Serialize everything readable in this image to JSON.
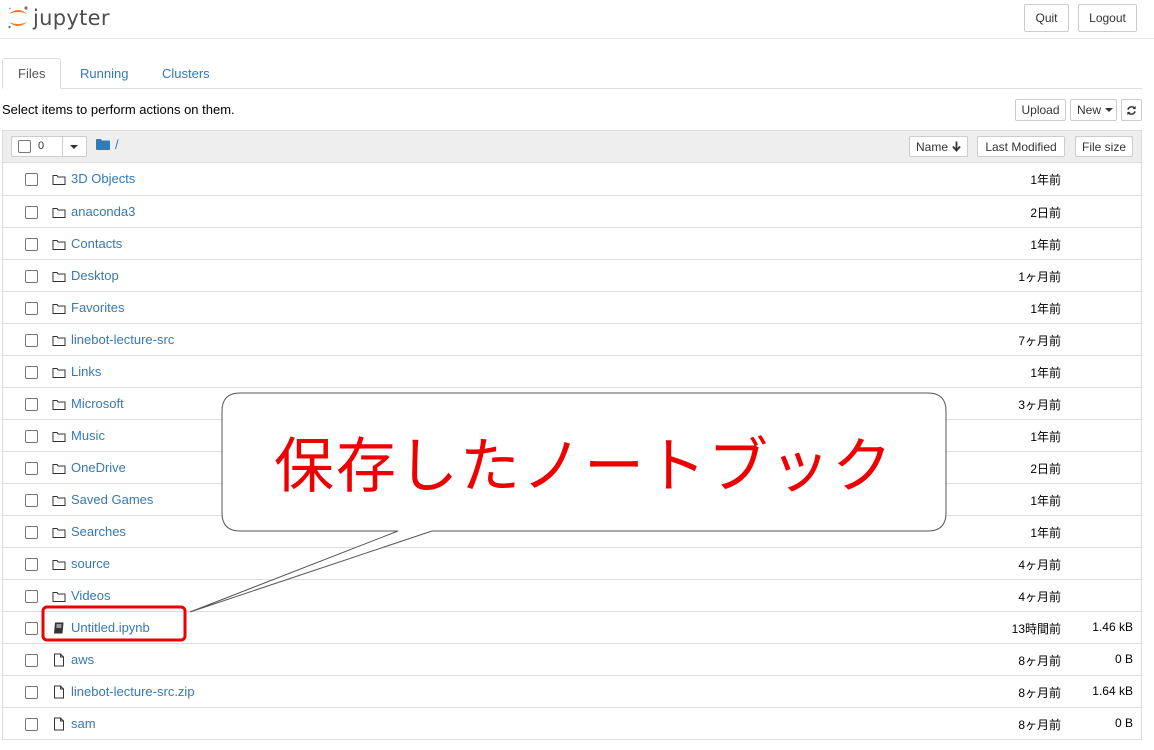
{
  "header": {
    "logo_text": "jupyter",
    "quit_label": "Quit",
    "logout_label": "Logout"
  },
  "tabs": [
    {
      "label": "Files",
      "active": true
    },
    {
      "label": "Running",
      "active": false
    },
    {
      "label": "Clusters",
      "active": false
    }
  ],
  "toolbar": {
    "hint": "Select items to perform actions on them.",
    "upload_label": "Upload",
    "new_label": "New",
    "refresh_icon": "refresh-icon"
  },
  "list_header": {
    "selected_count": "0",
    "breadcrumb": "/",
    "name_label": "Name",
    "last_modified_label": "Last Modified",
    "file_size_label": "File size"
  },
  "files": [
    {
      "name": "3D Objects",
      "type": "folder",
      "modified": "1年前",
      "size": ""
    },
    {
      "name": "anaconda3",
      "type": "folder",
      "modified": "2日前",
      "size": ""
    },
    {
      "name": "Contacts",
      "type": "folder",
      "modified": "1年前",
      "size": ""
    },
    {
      "name": "Desktop",
      "type": "folder",
      "modified": "1ヶ月前",
      "size": ""
    },
    {
      "name": "Favorites",
      "type": "folder",
      "modified": "1年前",
      "size": ""
    },
    {
      "name": "linebot-lecture-src",
      "type": "folder",
      "modified": "7ヶ月前",
      "size": ""
    },
    {
      "name": "Links",
      "type": "folder",
      "modified": "1年前",
      "size": ""
    },
    {
      "name": "Microsoft",
      "type": "folder",
      "modified": "3ヶ月前",
      "size": ""
    },
    {
      "name": "Music",
      "type": "folder",
      "modified": "1年前",
      "size": ""
    },
    {
      "name": "OneDrive",
      "type": "folder",
      "modified": "2日前",
      "size": ""
    },
    {
      "name": "Saved Games",
      "type": "folder",
      "modified": "1年前",
      "size": ""
    },
    {
      "name": "Searches",
      "type": "folder",
      "modified": "1年前",
      "size": ""
    },
    {
      "name": "source",
      "type": "folder",
      "modified": "4ヶ月前",
      "size": ""
    },
    {
      "name": "Videos",
      "type": "folder",
      "modified": "4ヶ月前",
      "size": ""
    },
    {
      "name": "Untitled.ipynb",
      "type": "notebook",
      "modified": "13時間前",
      "size": "1.46 kB"
    },
    {
      "name": "aws",
      "type": "file",
      "modified": "8ヶ月前",
      "size": "0 B"
    },
    {
      "name": "linebot-lecture-src.zip",
      "type": "file",
      "modified": "8ヶ月前",
      "size": "1.64 kB"
    },
    {
      "name": "sam",
      "type": "file",
      "modified": "8ヶ月前",
      "size": "0 B"
    }
  ],
  "annotation": {
    "text": "保存したノートブック",
    "color": "#ee0000"
  },
  "colors": {
    "link": "#337ab7",
    "logo_orange": "#f37726"
  }
}
